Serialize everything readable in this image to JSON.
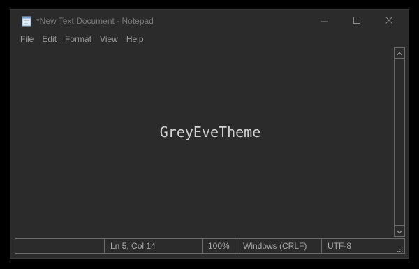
{
  "window": {
    "title": "*New Text Document - Notepad",
    "controls": [
      "minimize-icon",
      "maximize-icon",
      "close-icon"
    ]
  },
  "menu": {
    "items": [
      "File",
      "Edit",
      "Format",
      "View",
      "Help"
    ]
  },
  "editor": {
    "content": "GreyEveTheme"
  },
  "statusbar": {
    "position": "Ln 5, Col 14",
    "zoom": "100%",
    "line_ending": "Windows (CRLF)",
    "encoding": "UTF-8"
  },
  "colors": {
    "background": "#2b2b2b",
    "text": "#d2d2d2",
    "chrome_text": "#8f8f8f",
    "border": "#6b6b6b"
  }
}
